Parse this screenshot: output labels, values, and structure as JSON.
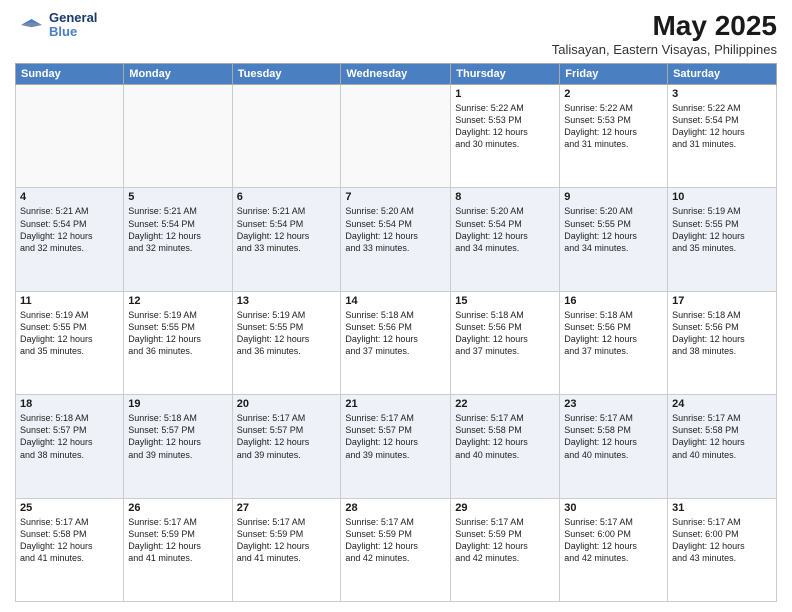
{
  "header": {
    "logo_line1": "General",
    "logo_line2": "Blue",
    "month_year": "May 2025",
    "location": "Talisayan, Eastern Visayas, Philippines"
  },
  "weekdays": [
    "Sunday",
    "Monday",
    "Tuesday",
    "Wednesday",
    "Thursday",
    "Friday",
    "Saturday"
  ],
  "weeks": [
    [
      {
        "day": "",
        "info": ""
      },
      {
        "day": "",
        "info": ""
      },
      {
        "day": "",
        "info": ""
      },
      {
        "day": "",
        "info": ""
      },
      {
        "day": "1",
        "info": "Sunrise: 5:22 AM\nSunset: 5:53 PM\nDaylight: 12 hours\nand 30 minutes."
      },
      {
        "day": "2",
        "info": "Sunrise: 5:22 AM\nSunset: 5:53 PM\nDaylight: 12 hours\nand 31 minutes."
      },
      {
        "day": "3",
        "info": "Sunrise: 5:22 AM\nSunset: 5:54 PM\nDaylight: 12 hours\nand 31 minutes."
      }
    ],
    [
      {
        "day": "4",
        "info": "Sunrise: 5:21 AM\nSunset: 5:54 PM\nDaylight: 12 hours\nand 32 minutes."
      },
      {
        "day": "5",
        "info": "Sunrise: 5:21 AM\nSunset: 5:54 PM\nDaylight: 12 hours\nand 32 minutes."
      },
      {
        "day": "6",
        "info": "Sunrise: 5:21 AM\nSunset: 5:54 PM\nDaylight: 12 hours\nand 33 minutes."
      },
      {
        "day": "7",
        "info": "Sunrise: 5:20 AM\nSunset: 5:54 PM\nDaylight: 12 hours\nand 33 minutes."
      },
      {
        "day": "8",
        "info": "Sunrise: 5:20 AM\nSunset: 5:54 PM\nDaylight: 12 hours\nand 34 minutes."
      },
      {
        "day": "9",
        "info": "Sunrise: 5:20 AM\nSunset: 5:55 PM\nDaylight: 12 hours\nand 34 minutes."
      },
      {
        "day": "10",
        "info": "Sunrise: 5:19 AM\nSunset: 5:55 PM\nDaylight: 12 hours\nand 35 minutes."
      }
    ],
    [
      {
        "day": "11",
        "info": "Sunrise: 5:19 AM\nSunset: 5:55 PM\nDaylight: 12 hours\nand 35 minutes."
      },
      {
        "day": "12",
        "info": "Sunrise: 5:19 AM\nSunset: 5:55 PM\nDaylight: 12 hours\nand 36 minutes."
      },
      {
        "day": "13",
        "info": "Sunrise: 5:19 AM\nSunset: 5:55 PM\nDaylight: 12 hours\nand 36 minutes."
      },
      {
        "day": "14",
        "info": "Sunrise: 5:18 AM\nSunset: 5:56 PM\nDaylight: 12 hours\nand 37 minutes."
      },
      {
        "day": "15",
        "info": "Sunrise: 5:18 AM\nSunset: 5:56 PM\nDaylight: 12 hours\nand 37 minutes."
      },
      {
        "day": "16",
        "info": "Sunrise: 5:18 AM\nSunset: 5:56 PM\nDaylight: 12 hours\nand 37 minutes."
      },
      {
        "day": "17",
        "info": "Sunrise: 5:18 AM\nSunset: 5:56 PM\nDaylight: 12 hours\nand 38 minutes."
      }
    ],
    [
      {
        "day": "18",
        "info": "Sunrise: 5:18 AM\nSunset: 5:57 PM\nDaylight: 12 hours\nand 38 minutes."
      },
      {
        "day": "19",
        "info": "Sunrise: 5:18 AM\nSunset: 5:57 PM\nDaylight: 12 hours\nand 39 minutes."
      },
      {
        "day": "20",
        "info": "Sunrise: 5:17 AM\nSunset: 5:57 PM\nDaylight: 12 hours\nand 39 minutes."
      },
      {
        "day": "21",
        "info": "Sunrise: 5:17 AM\nSunset: 5:57 PM\nDaylight: 12 hours\nand 39 minutes."
      },
      {
        "day": "22",
        "info": "Sunrise: 5:17 AM\nSunset: 5:58 PM\nDaylight: 12 hours\nand 40 minutes."
      },
      {
        "day": "23",
        "info": "Sunrise: 5:17 AM\nSunset: 5:58 PM\nDaylight: 12 hours\nand 40 minutes."
      },
      {
        "day": "24",
        "info": "Sunrise: 5:17 AM\nSunset: 5:58 PM\nDaylight: 12 hours\nand 40 minutes."
      }
    ],
    [
      {
        "day": "25",
        "info": "Sunrise: 5:17 AM\nSunset: 5:58 PM\nDaylight: 12 hours\nand 41 minutes."
      },
      {
        "day": "26",
        "info": "Sunrise: 5:17 AM\nSunset: 5:59 PM\nDaylight: 12 hours\nand 41 minutes."
      },
      {
        "day": "27",
        "info": "Sunrise: 5:17 AM\nSunset: 5:59 PM\nDaylight: 12 hours\nand 41 minutes."
      },
      {
        "day": "28",
        "info": "Sunrise: 5:17 AM\nSunset: 5:59 PM\nDaylight: 12 hours\nand 42 minutes."
      },
      {
        "day": "29",
        "info": "Sunrise: 5:17 AM\nSunset: 5:59 PM\nDaylight: 12 hours\nand 42 minutes."
      },
      {
        "day": "30",
        "info": "Sunrise: 5:17 AM\nSunset: 6:00 PM\nDaylight: 12 hours\nand 42 minutes."
      },
      {
        "day": "31",
        "info": "Sunrise: 5:17 AM\nSunset: 6:00 PM\nDaylight: 12 hours\nand 43 minutes."
      }
    ]
  ]
}
